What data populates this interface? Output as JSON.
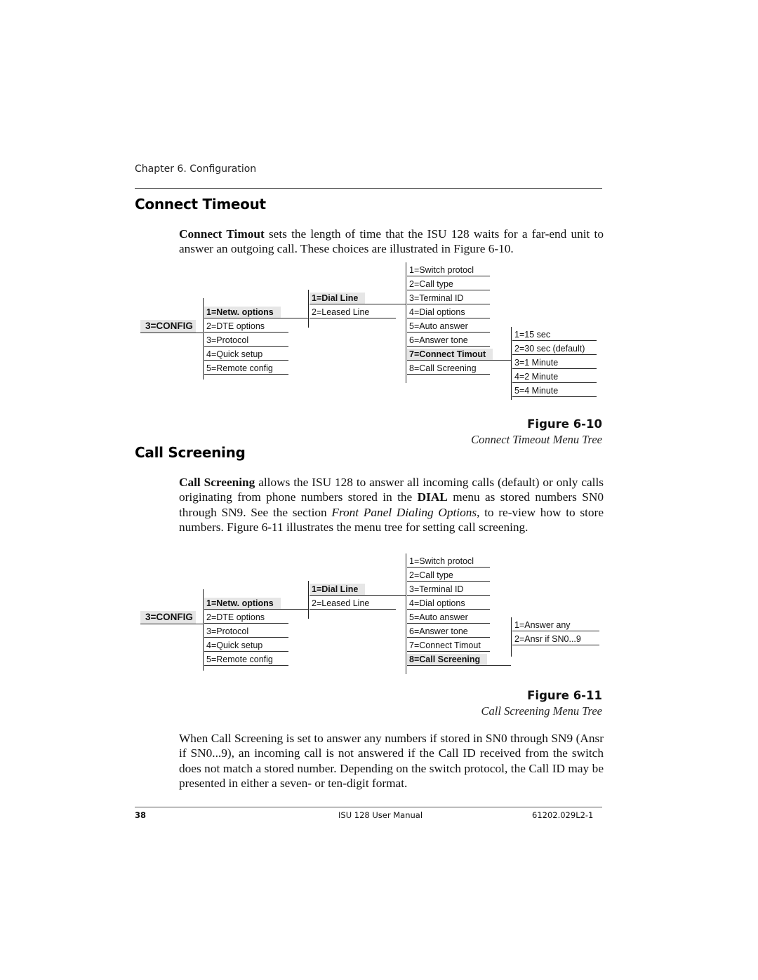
{
  "header": {
    "running_head": "Chapter 6. Configuration"
  },
  "section1": {
    "heading": "Connect Timeout",
    "para_bold": "Connect Timout",
    "para_rest": " sets the length of time that the ISU 128 waits for a far-end unit to answer an outgoing call.  These choices are illustrated in Figure 6-10."
  },
  "figure1": {
    "title": "Figure 6-10",
    "caption": "Connect Timeout Menu Tree",
    "root": "3=CONFIG",
    "level1": [
      "1=Netw. options",
      "2=DTE options",
      "3=Protocol",
      "4=Quick setup",
      "5=Remote config"
    ],
    "level2": [
      "1=Dial Line",
      "2=Leased Line"
    ],
    "level3": [
      "1=Switch protocl",
      "2=Call type",
      "3=Terminal ID",
      "4=Dial options",
      "5=Auto answer",
      "6=Answer tone",
      "7=Connect Timout",
      "8=Call Screening"
    ],
    "level4": [
      "1=15 sec",
      "2=30 sec (default)",
      "3=1 Minute",
      "4=2 Minute",
      "5=4 Minute"
    ],
    "selected": {
      "level1": "1=Netw. options",
      "level2": "1=Dial Line",
      "level3": "7=Connect Timout"
    }
  },
  "section2": {
    "heading": "Call Screening",
    "p1_bold1": "Call Screening",
    "p1_text1": " allows the ISU 128 to answer all incoming calls (default) or only calls originating from phone numbers stored in the ",
    "p1_bold2": "DIAL",
    "p1_text2": " menu as stored numbers SN0 through SN9.  See the section ",
    "p1_italic": "Front Panel Dialing Options",
    "p1_text3": ", to re-view how to store numbers.  Figure 6-11 illustrates the menu tree for setting call screening.",
    "p2": "When Call Screening is set to answer any numbers if stored in SN0 through SN9 (Ansr if SN0...9), an incoming call is not answered if the Call ID received from the switch does not match a stored number.  Depending on the switch protocol, the Call ID may be presented in either a seven- or ten-digit format."
  },
  "figure2": {
    "title": "Figure 6-11",
    "caption": "Call Screening Menu Tree",
    "root": "3=CONFIG",
    "level1": [
      "1=Netw. options",
      "2=DTE options",
      "3=Protocol",
      "4=Quick setup",
      "5=Remote config"
    ],
    "level2": [
      "1=Dial Line",
      "2=Leased Line"
    ],
    "level3": [
      "1=Switch protocl",
      "2=Call type",
      "3=Terminal ID",
      "4=Dial options",
      "5=Auto answer",
      "6=Answer tone",
      "7=Connect Timout",
      "8=Call Screening"
    ],
    "level4": [
      "1=Answer any",
      "2=Ansr if SN0...9"
    ],
    "selected": {
      "level1": "1=Netw. options",
      "level2": "1=Dial Line",
      "level3": "8=Call Screening"
    }
  },
  "footer": {
    "page_number": "38",
    "manual_title": "ISU 128 User Manual",
    "doc_number": "61202.029L2-1"
  }
}
